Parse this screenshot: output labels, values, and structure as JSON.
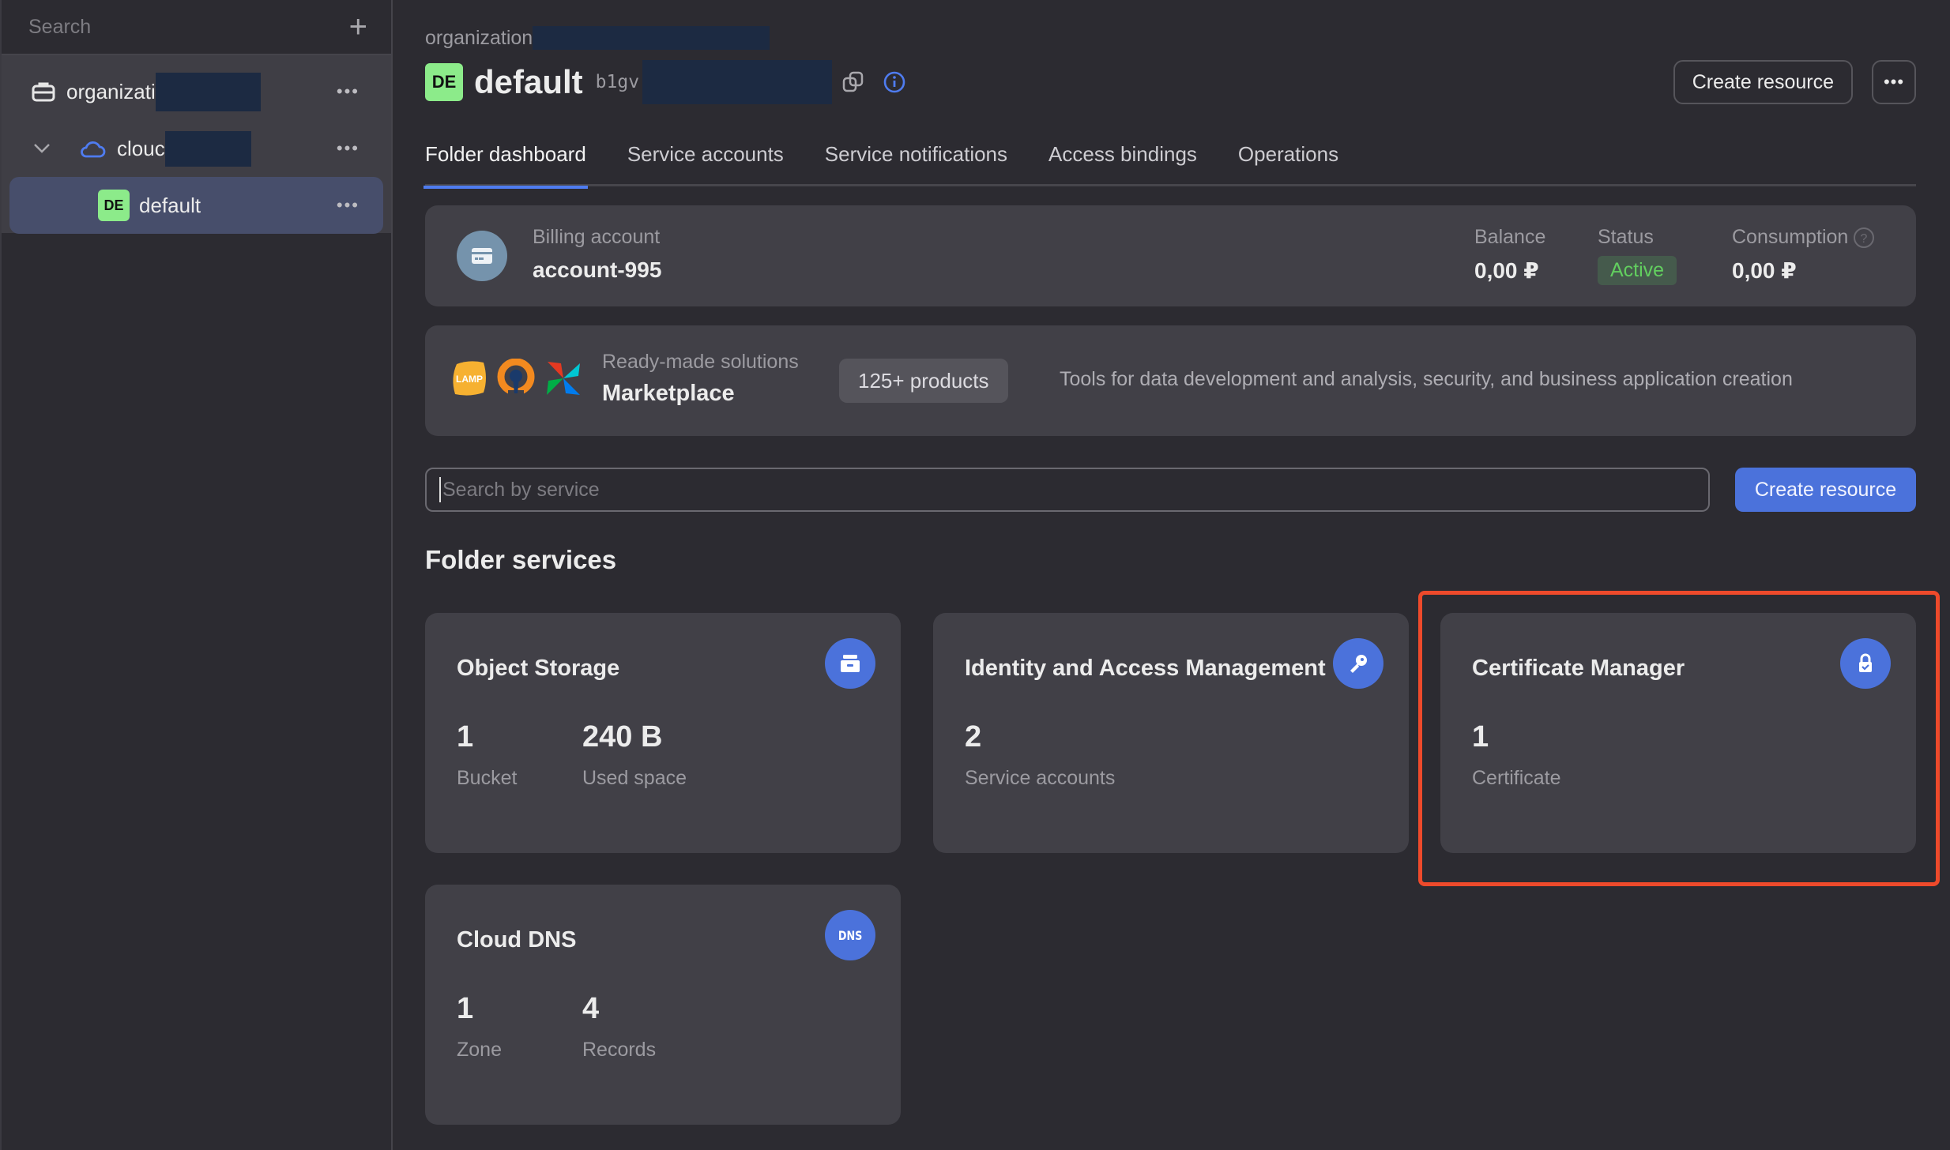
{
  "sidebar": {
    "search_placeholder": "Search",
    "add_icon": "plus-icon",
    "tree": [
      {
        "label": "organizati",
        "icon": "briefcase-icon",
        "redacted": true
      },
      {
        "label": "clouc",
        "icon": "cloud-icon",
        "redacted": true,
        "expanded": true
      },
      {
        "label": "default",
        "badge": "DE",
        "active": true
      }
    ],
    "more_label": "•••"
  },
  "header": {
    "breadcrumb": "organization",
    "folder_badge": "DE",
    "title": "default",
    "folder_id_prefix": "b1gv",
    "create_resource_label": "Create resource",
    "more_label": "•••"
  },
  "tabs": [
    {
      "label": "Folder dashboard",
      "active": true
    },
    {
      "label": "Service accounts"
    },
    {
      "label": "Service notifications"
    },
    {
      "label": "Access bindings"
    },
    {
      "label": "Operations"
    }
  ],
  "billing": {
    "label": "Billing account",
    "account": "account-995",
    "balance_label": "Balance",
    "balance": "0,00 ₽",
    "status_label": "Status",
    "status": "Active",
    "consumption_label": "Consumption",
    "consumption": "0,00 ₽",
    "status_color": "#62cf5f"
  },
  "marketplace": {
    "subtitle": "Ready-made solutions",
    "title": "Marketplace",
    "products": "125+ products",
    "description": "Tools for data development and analysis, security, and business application creation",
    "lamp_label": "LAMP"
  },
  "search": {
    "placeholder": "Search by service",
    "value": "",
    "create_label": "Create resource"
  },
  "services": {
    "title": "Folder services",
    "cards": [
      {
        "title": "Object Storage",
        "icon": "archive-icon",
        "metrics": [
          {
            "value": "1",
            "label": "Bucket"
          },
          {
            "value": "240 B",
            "label": "Used space"
          }
        ]
      },
      {
        "title": "Identity and Access Management",
        "icon": "key-icon",
        "metrics": [
          {
            "value": "2",
            "label": "Service accounts"
          }
        ]
      },
      {
        "title": "Certificate Manager",
        "icon": "lock-icon",
        "metrics": [
          {
            "value": "1",
            "label": "Certificate"
          }
        ],
        "highlighted": true
      },
      {
        "title": "Cloud DNS",
        "icon": "dns-icon",
        "icon_text": "DNS",
        "metrics": [
          {
            "value": "1",
            "label": "Zone"
          },
          {
            "value": "4",
            "label": "Records"
          }
        ]
      }
    ]
  },
  "colors": {
    "accent": "#4b72db",
    "highlight": "#ee4a2b",
    "badge_green": "#8ceb8a"
  }
}
